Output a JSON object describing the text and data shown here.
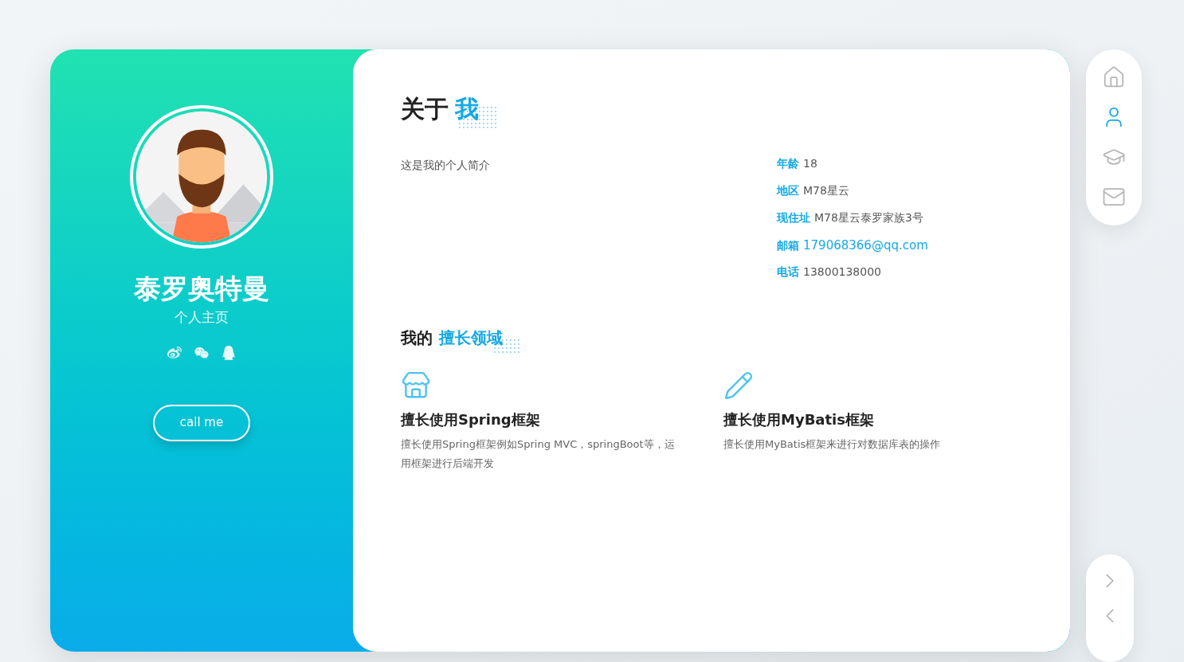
{
  "profile": {
    "name": "泰罗奥特曼",
    "subtitle": "个人主页",
    "socials": [
      {
        "kind": "weibo"
      },
      {
        "kind": "wechat"
      },
      {
        "kind": "qq"
      }
    ],
    "button": "call me"
  },
  "about": {
    "title": "关于",
    "title_highlight": "我",
    "bio": "这是我的个人简介",
    "info": [
      {
        "label": "年龄",
        "value": "18",
        "kind": "text"
      },
      {
        "label": "地区",
        "value": "M78星云",
        "kind": "text"
      },
      {
        "label": "现住址",
        "value": "M78星云泰罗家族3号",
        "kind": "text"
      },
      {
        "label": "邮箱",
        "value": "179068366@qq.com",
        "kind": "link"
      },
      {
        "label": "电话",
        "value": "13800138000",
        "kind": "text"
      }
    ]
  },
  "skills": {
    "title": "我的",
    "title_highlight": "擅长领域",
    "items": [
      {
        "kind": "store",
        "title": "擅长使用Spring框架",
        "description": "擅长使用Spring框架例如Spring MVC，springBoot等，运用框架进行后端开发"
      },
      {
        "kind": "pencil",
        "title": "擅长使用MyBatis框架",
        "description": "擅长使用MyBatis框架来进行对数据库表的操作"
      }
    ]
  },
  "nav": {
    "items": [
      {
        "kind": "home",
        "selected": false
      },
      {
        "kind": "user",
        "selected": true
      },
      {
        "kind": "education",
        "selected": false
      },
      {
        "kind": "mail",
        "selected": false
      }
    ]
  },
  "pager": [
    {
      "kind": "next"
    },
    {
      "kind": "prev"
    }
  ]
}
